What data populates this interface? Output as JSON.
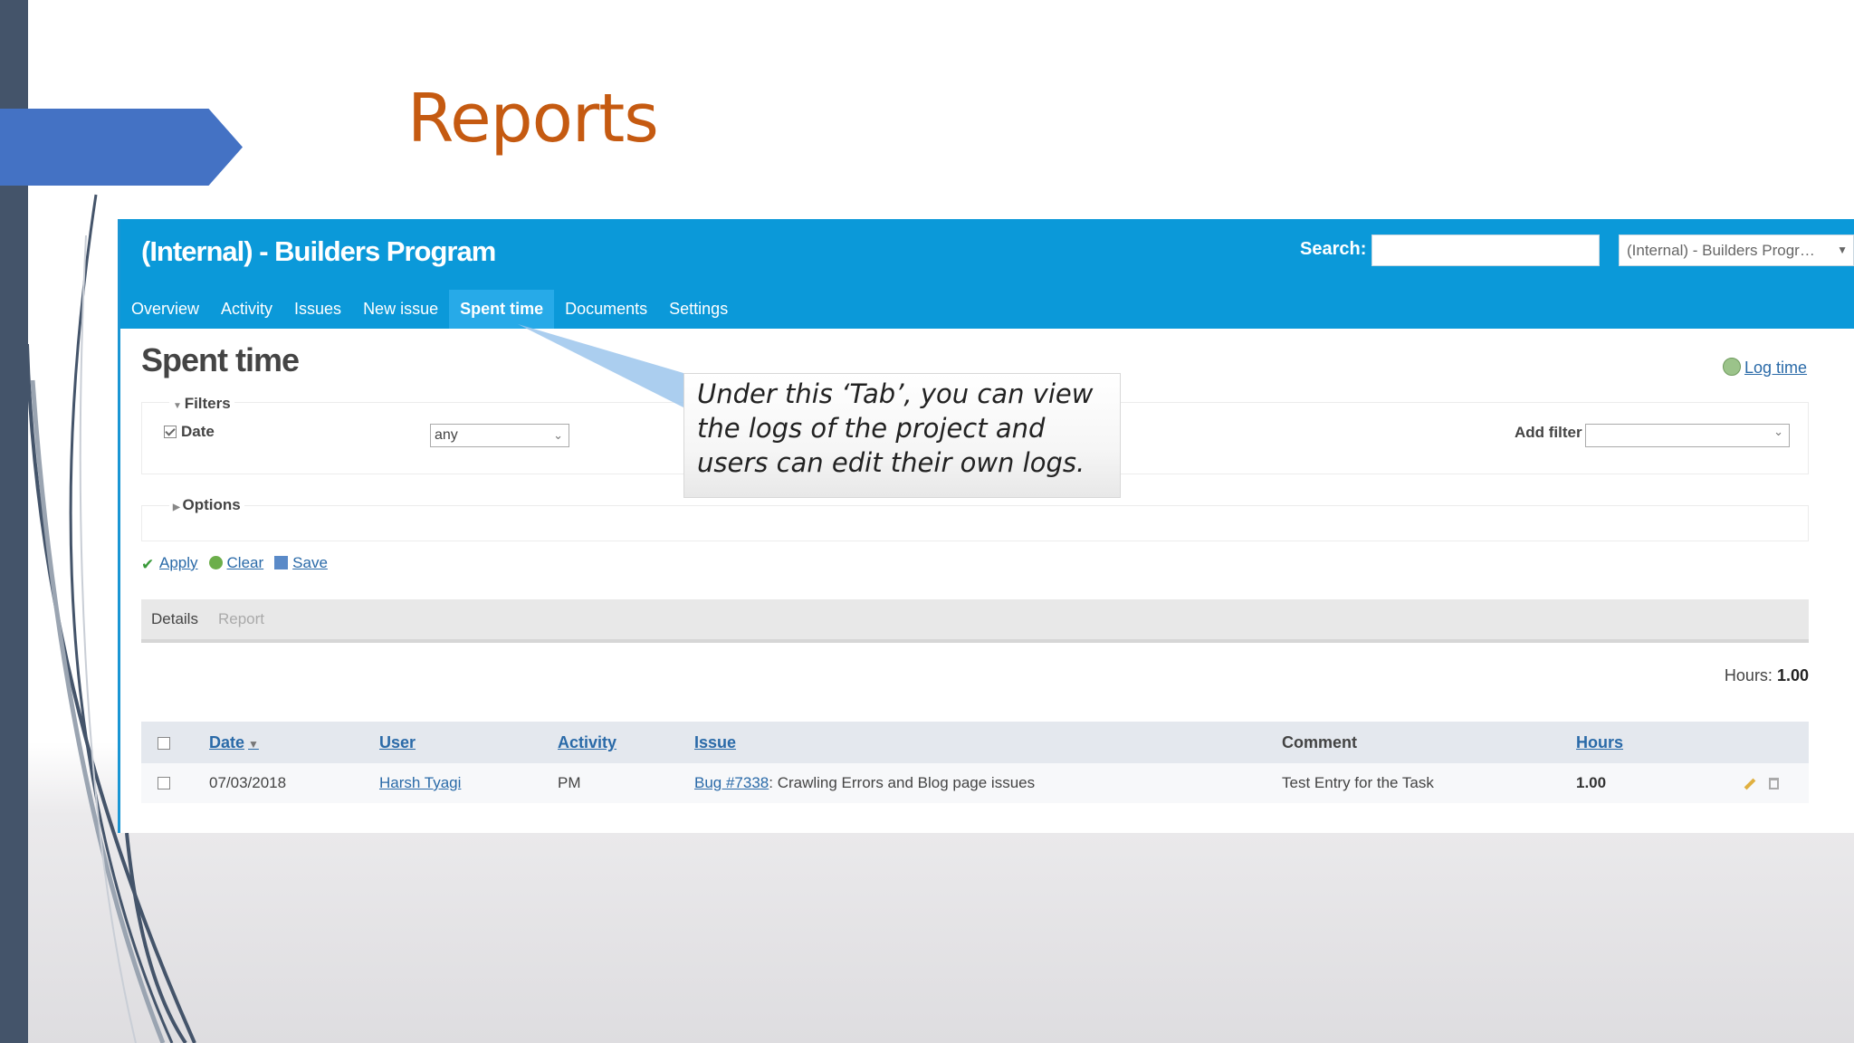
{
  "slide": {
    "title": "Reports"
  },
  "header": {
    "project_title": "(Internal) - Builders Program",
    "search_label": "Search:",
    "search_value": "",
    "project_select_value": "(Internal) - Builders Progr…"
  },
  "menu": [
    {
      "label": "Overview"
    },
    {
      "label": "Activity"
    },
    {
      "label": "Issues"
    },
    {
      "label": "New issue"
    },
    {
      "label": "Spent time",
      "selected": true
    },
    {
      "label": "Documents"
    },
    {
      "label": "Settings"
    }
  ],
  "content": {
    "page_title": "Spent time",
    "log_time": "Log time",
    "filters_label": "Filters",
    "date_filter_label": "Date",
    "date_filter_value": "any",
    "add_filter_label": "Add filter",
    "options_label": "Options",
    "actions": {
      "apply": "Apply",
      "clear": "Clear",
      "save": "Save"
    },
    "tabs": {
      "details": "Details",
      "report": "Report"
    },
    "hours_label": "Hours:",
    "hours_value": "1.00"
  },
  "table": {
    "headers": {
      "date": "Date",
      "user": "User",
      "activity": "Activity",
      "issue": "Issue",
      "comment": "Comment",
      "hours": "Hours"
    },
    "rows": [
      {
        "date": "07/03/2018",
        "user": "Harsh Tyagi",
        "activity": "PM",
        "issue_link": "Bug #7338",
        "issue_text": ": Crawling Errors and Blog page issues",
        "comment": "Test Entry for the Task",
        "hours": "1.00"
      }
    ]
  },
  "callout": {
    "text": "Under this ‘Tab’, you can view the logs of the project and users can edit their own logs."
  },
  "colors": {
    "header_blue": "#0b99d9",
    "selected_tab": "#27aae8",
    "title_orange": "#c55a11",
    "arrow_blue": "#4472c4",
    "left_bar": "#44546a"
  }
}
